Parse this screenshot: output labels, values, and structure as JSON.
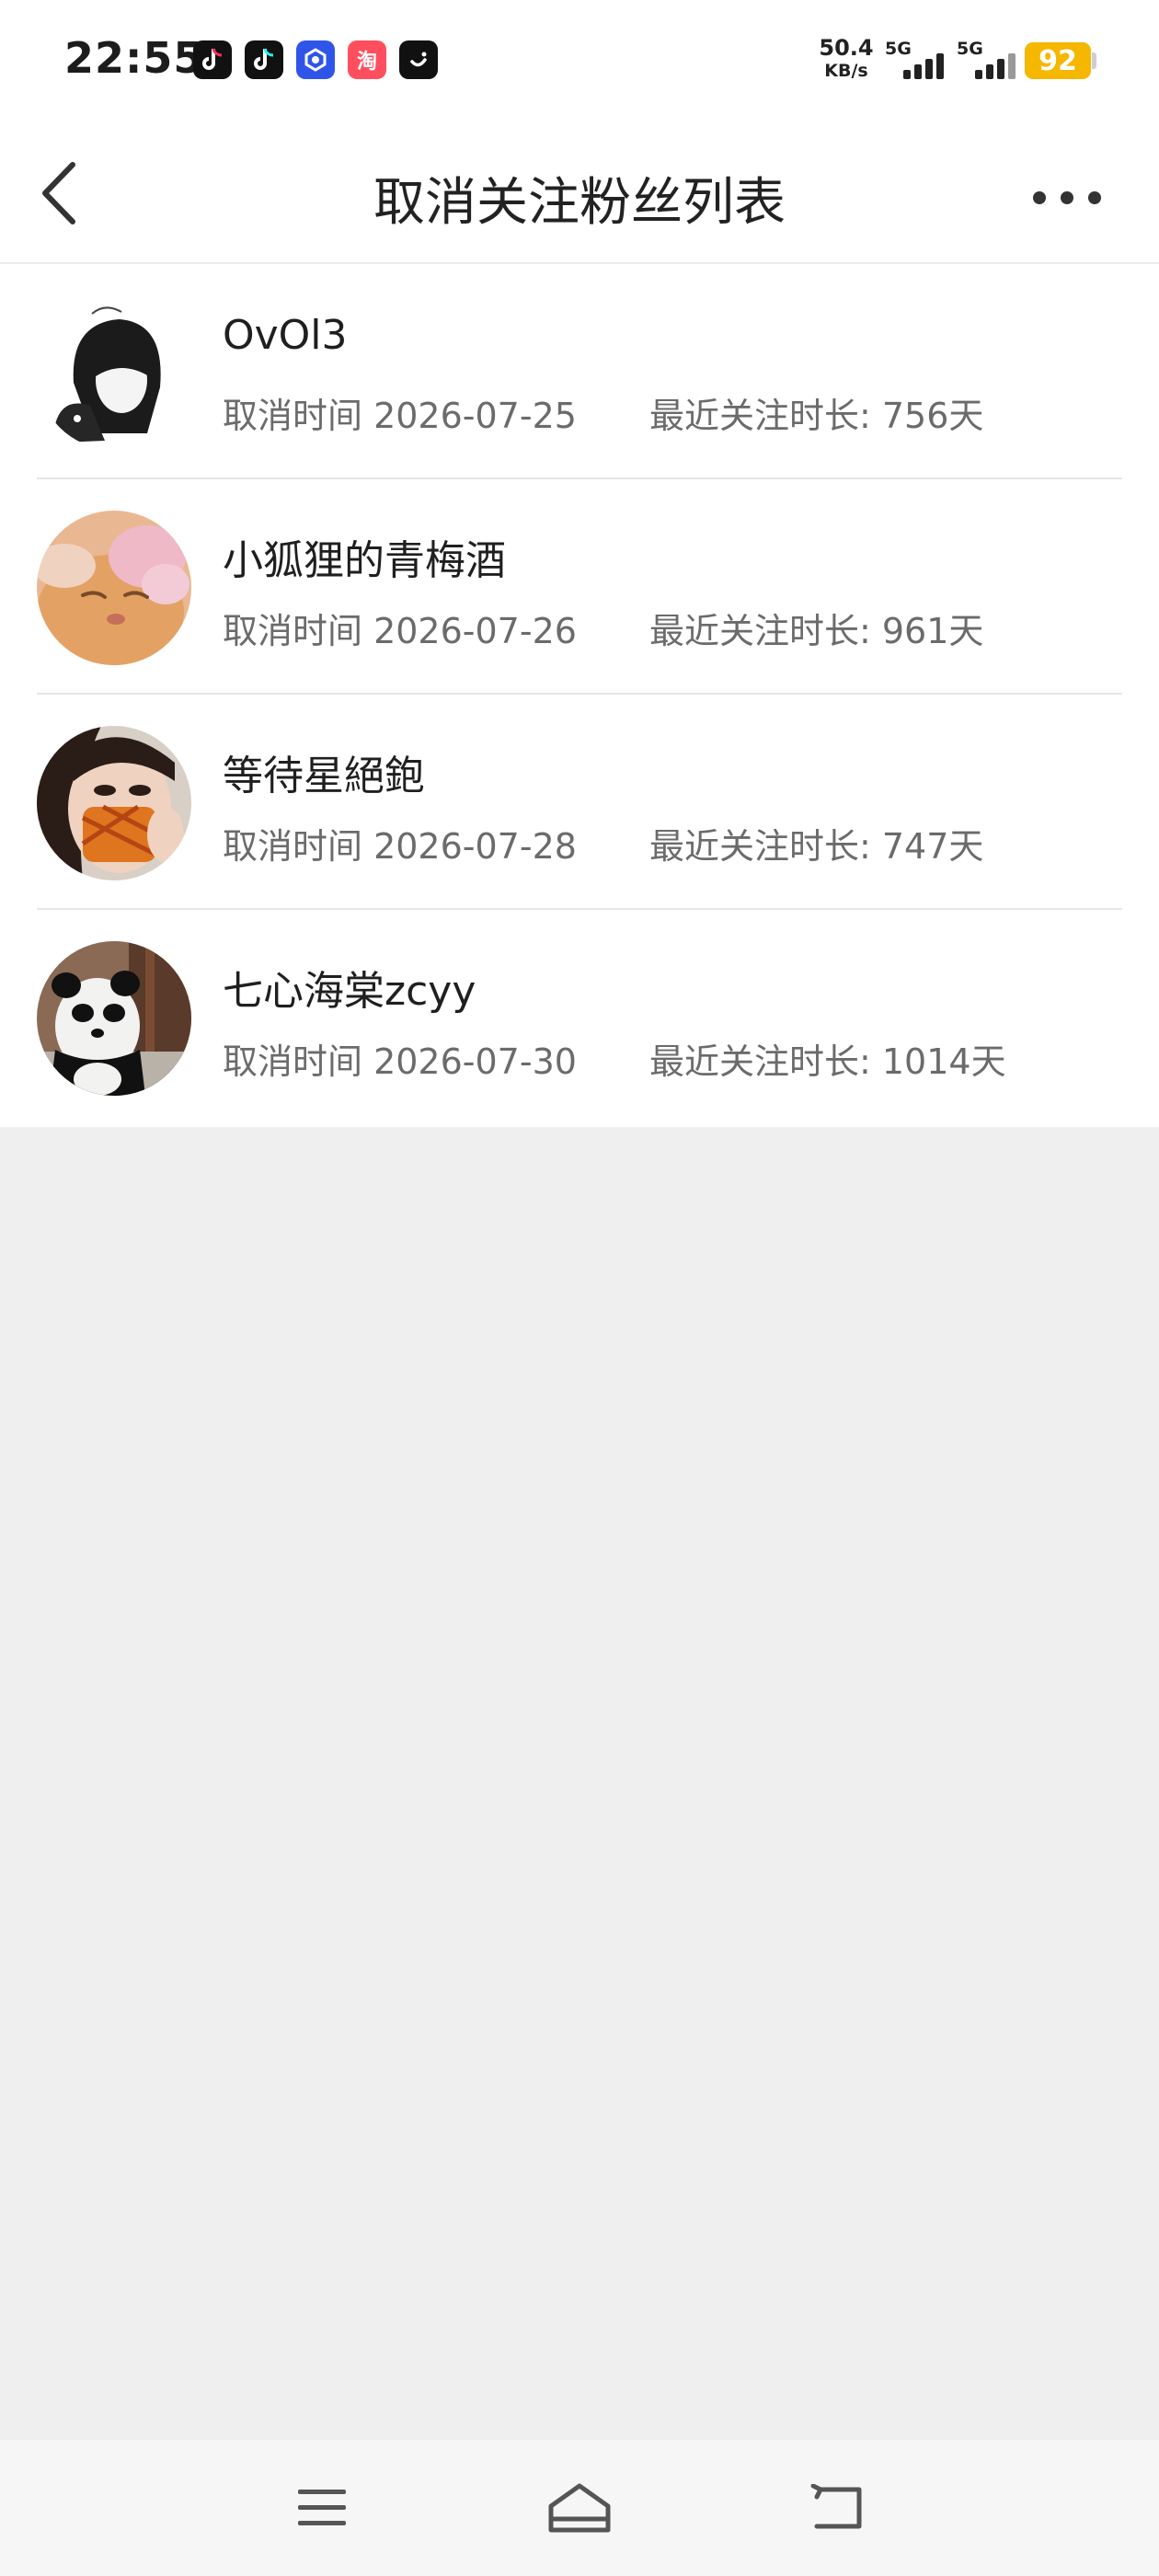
{
  "status_bar": {
    "time": "22:55",
    "net_speed_value": "50.4",
    "net_speed_unit": "KB/s",
    "signal_1_label": "5G",
    "signal_2_label": "5G",
    "battery": "92",
    "apps": [
      {
        "icon": "tiktok-icon"
      },
      {
        "icon": "tiktok-icon"
      },
      {
        "icon": "blue-app-icon"
      },
      {
        "icon": "taobao-icon",
        "glyph": "淘"
      },
      {
        "icon": "smile-app-icon"
      }
    ]
  },
  "header": {
    "title": "取消关注粉丝列表",
    "back_icon": "chevron-left-icon",
    "more_icon": "more-dots-icon"
  },
  "fans": [
    {
      "name": "OvOl3",
      "cancel_label": "取消时间",
      "cancel_date": "2026-07-25",
      "duration_label": "最近关注时长:",
      "duration": "756天",
      "cancel_text": "取消时间 2026-07-25",
      "duration_text": "最近关注时长: 756天"
    },
    {
      "name": "小狐狸的青梅酒",
      "cancel_label": "取消时间",
      "cancel_date": "2026-07-26",
      "duration_label": "最近关注时长:",
      "duration": "961天",
      "cancel_text": "取消时间 2026-07-26",
      "duration_text": "最近关注时长: 961天"
    },
    {
      "name": "等待星絕鉋",
      "cancel_label": "取消时间",
      "cancel_date": "2026-07-28",
      "duration_label": "最近关注时长:",
      "duration": "747天",
      "cancel_text": "取消时间 2026-07-28",
      "duration_text": "最近关注时长: 747天"
    },
    {
      "name": "七心海棠zcyy",
      "cancel_label": "取消时间",
      "cancel_date": "2026-07-30",
      "duration_label": "最近关注时长:",
      "duration": "1014天",
      "cancel_text": "取消时间 2026-07-30",
      "duration_text": "最近关注时长: 1014天"
    }
  ],
  "nav_bar": {
    "menu_icon": "menu-icon",
    "home_icon": "home-icon",
    "back_icon": "back-arrow-icon"
  }
}
